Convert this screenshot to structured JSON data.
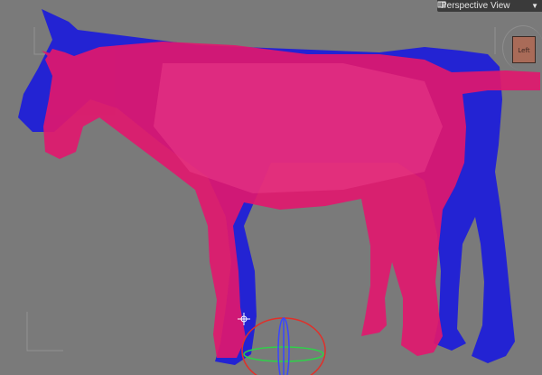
{
  "viewport": {
    "view_label": "Perspective View",
    "camera_icon": "camera-icon",
    "caret_icon": "chevron-down-icon",
    "nav_cube_label": "Left",
    "colors": {
      "background": "#7a7a7a",
      "blue_horse": "#1f1fd8",
      "pink_horse": "#e0186e",
      "gizmo_red": "#e0302a",
      "gizmo_green": "#2fd04a",
      "gizmo_blue": "#3a46ff"
    }
  }
}
